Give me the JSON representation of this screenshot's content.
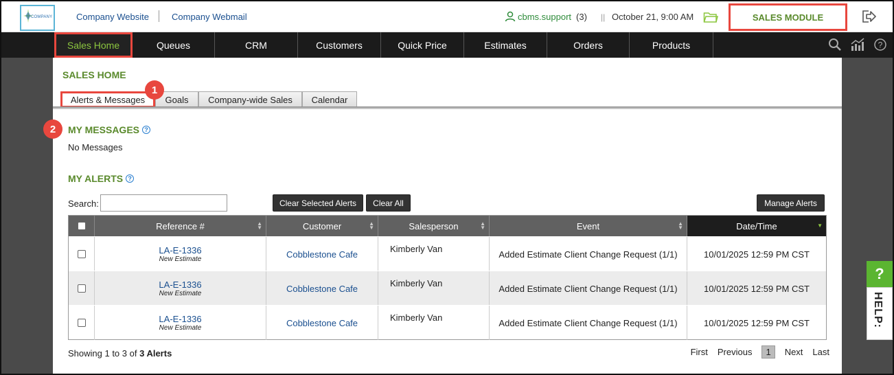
{
  "topbar": {
    "logo_text": "COMPANY",
    "links": [
      "Company Website",
      "Company Webmail"
    ],
    "user_name": "cbms.support",
    "user_count": "(3)",
    "separator": "||",
    "datetime": "October 21, 9:00 AM",
    "module_label": "SALES MODULE"
  },
  "nav": {
    "items": [
      "Sales Home",
      "Queues",
      "CRM",
      "Customers",
      "Quick Price",
      "Estimates",
      "Orders",
      "Products"
    ]
  },
  "page": {
    "title": "SALES HOME",
    "tabs": [
      "Alerts & Messages",
      "Goals",
      "Company-wide Sales",
      "Calendar"
    ],
    "badges": [
      "1",
      "2"
    ],
    "messages_title": "MY MESSAGES",
    "no_messages": "No Messages",
    "alerts_title": "MY ALERTS",
    "search_label": "Search:",
    "search_value": "",
    "buttons": {
      "clear_selected": "Clear Selected Alerts",
      "clear_all": "Clear All",
      "manage": "Manage Alerts"
    }
  },
  "table": {
    "headers": [
      "Reference #",
      "Customer",
      "Salesperson",
      "Event",
      "Date/Time"
    ],
    "rows": [
      {
        "ref": "LA-E-1336",
        "ref_sub": "New Estimate",
        "customer": "Cobblestone Cafe",
        "salesperson": "Kimberly Van",
        "event": "Added Estimate Client Change Request (1/1)",
        "datetime": "10/01/2025 12:59 PM CST"
      },
      {
        "ref": "LA-E-1336",
        "ref_sub": "New Estimate",
        "customer": "Cobblestone Cafe",
        "salesperson": "Kimberly Van",
        "event": "Added Estimate Client Change Request (1/1)",
        "datetime": "10/01/2025 12:59 PM CST"
      },
      {
        "ref": "LA-E-1336",
        "ref_sub": "New Estimate",
        "customer": "Cobblestone Cafe",
        "salesperson": "Kimberly Van",
        "event": "Added Estimate Client Change Request (1/1)",
        "datetime": "10/01/2025 12:59 PM CST"
      }
    ],
    "showing_prefix": "Showing 1 to 3 of",
    "showing_total": "3 Alerts",
    "pager": {
      "first": "First",
      "previous": "Previous",
      "current": "1",
      "next": "Next",
      "last": "Last"
    }
  },
  "help_tab": {
    "q": "?",
    "word": "HELP:"
  },
  "colors": {
    "accent_red": "#e8473e",
    "brand_green": "#5a8a2c",
    "nav_bg": "#1b1b1b",
    "link_blue": "#1a4f8f"
  }
}
